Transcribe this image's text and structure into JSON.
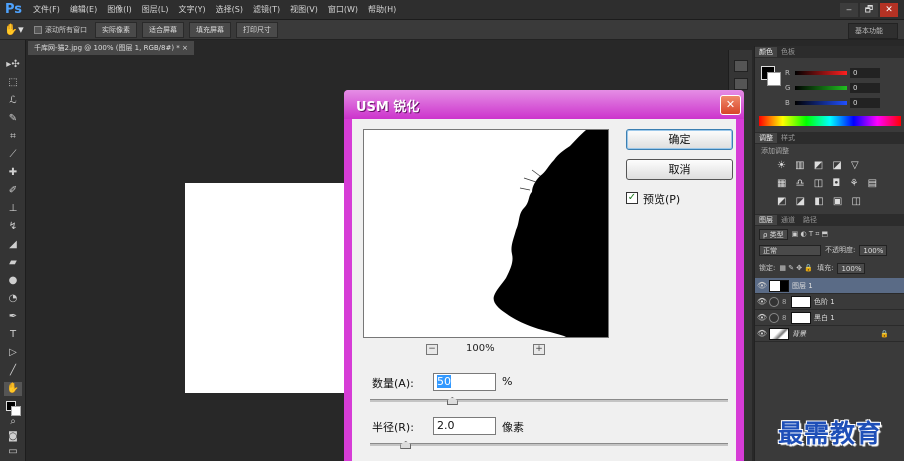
{
  "app": {
    "logo": "Ps",
    "menu": [
      "文件(F)",
      "编辑(E)",
      "图像(I)",
      "图层(L)",
      "文字(Y)",
      "选择(S)",
      "滤镜(T)",
      "视图(V)",
      "窗口(W)",
      "帮助(H)"
    ],
    "window_controls": [
      "‒",
      "🗗",
      "✕"
    ]
  },
  "options": {
    "tool_icon": "hand-icon",
    "scroll_all_label": "滚动所有窗口",
    "buttons": [
      "实际像素",
      "适合屏幕",
      "填充屏幕",
      "打印尺寸"
    ],
    "workspace": "基本功能"
  },
  "document": {
    "tab_title": "千库网-猫2.jpg @ 100% (图层 1, RGB/8#) * ×"
  },
  "panels": {
    "color_tabs": [
      "颜色",
      "色板"
    ],
    "color_rows": [
      {
        "label": "R",
        "value": "0",
        "color": "#ff2020"
      },
      {
        "label": "G",
        "value": "0",
        "color": "#20c020"
      },
      {
        "label": "B",
        "value": "0",
        "color": "#2050ff"
      }
    ],
    "adjust_tabs": [
      "调整",
      "样式"
    ],
    "add_adjustment": "添加调整",
    "adj_icon_rows": [
      "☀ ▥ ◩ ◪ ▽",
      "▦ ♎ ◫ ◘ ⚘ ▤",
      "◩ ◪ ◧ ▣ ◫"
    ],
    "layers_tabs": [
      "图层",
      "通道",
      "路径"
    ],
    "kind_label": "ρ 类型",
    "blend_mode": "正常",
    "opacity_label": "不透明度:",
    "opacity_value": "100%",
    "lock_label": "锁定:",
    "fill_label": "填充:",
    "fill_value": "100%",
    "layers": [
      {
        "name": "图层 1",
        "selected": true,
        "kind": "image"
      },
      {
        "name": "色阶 1",
        "selected": false,
        "kind": "adjustment"
      },
      {
        "name": "黑白 1",
        "selected": false,
        "kind": "adjustment"
      },
      {
        "name": "背景",
        "selected": false,
        "kind": "background"
      }
    ]
  },
  "dialog": {
    "title": "USM 锐化",
    "close": "✕",
    "ok": "确定",
    "cancel": "取消",
    "preview_label": "预览(P)",
    "preview_checked": true,
    "zoom_out": "−",
    "zoom_in": "+",
    "zoom": "100%",
    "amount_label": "数量(A):",
    "amount_value": "50",
    "amount_unit": "%",
    "amount_fraction": 0.23,
    "radius_label": "半径(R):",
    "radius_value": "2.0",
    "radius_unit": "像素",
    "radius_fraction": 0.1
  },
  "watermark": "最需教育",
  "colors": {
    "dialog_frame": "#d63cd6",
    "ps_blue": "#4ea3ff",
    "watermark": "#1e4fb8"
  }
}
